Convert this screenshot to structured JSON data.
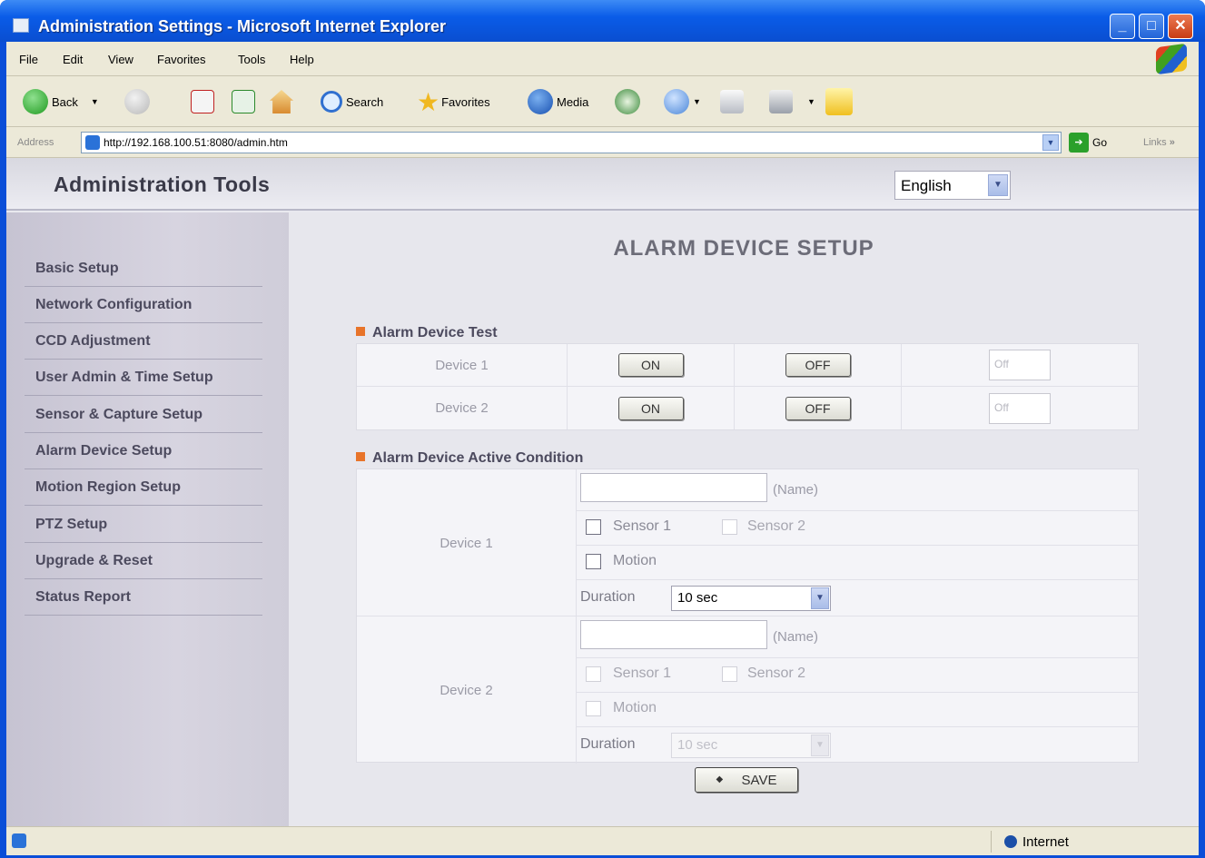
{
  "window": {
    "title": "Administration Settings - Microsoft Internet Explorer"
  },
  "menu": [
    "File",
    "Edit",
    "View",
    "Favorites",
    "Tools",
    "Help"
  ],
  "toolbar": {
    "back": "Back",
    "search": "Search",
    "favorites": "Favorites",
    "media": "Media"
  },
  "address": {
    "label": "Address",
    "url": "http://192.168.100.51:8080/admin.htm",
    "go": "Go",
    "links": "Links",
    "links_more": "»"
  },
  "header": {
    "title": "Administration Tools",
    "language": "English"
  },
  "nav": [
    "Basic Setup",
    "Network Configuration",
    "CCD Adjustment",
    "User Admin & Time Setup",
    "Sensor & Capture Setup",
    "Alarm Device Setup",
    "Motion Region Setup",
    "PTZ Setup",
    "Upgrade & Reset",
    "Status Report"
  ],
  "main": {
    "title": "ALARM DEVICE SETUP",
    "test": {
      "heading": "Alarm Device Test",
      "rows": [
        {
          "label": "Device 1",
          "on": "ON",
          "off": "OFF",
          "state": "Off"
        },
        {
          "label": "Device 2",
          "on": "ON",
          "off": "OFF",
          "state": "Off"
        }
      ]
    },
    "active": {
      "heading": "Alarm Device Active Condition",
      "devices": [
        {
          "label": "Device 1",
          "name_value": "",
          "name_hint": "(Name)",
          "sensor1": "Sensor 1",
          "sensor2": "Sensor 2",
          "motion": "Motion",
          "duration_label": "Duration",
          "duration": "10 sec"
        },
        {
          "label": "Device 2",
          "name_value": "",
          "name_hint": "(Name)",
          "sensor1": "Sensor 1",
          "sensor2": "Sensor 2",
          "motion": "Motion",
          "duration_label": "Duration",
          "duration": "10 sec"
        }
      ]
    },
    "save": "SAVE"
  },
  "status": {
    "zone": "Internet"
  },
  "icons": {
    "window": "ie-window-icon",
    "min": "minimize-icon",
    "max": "maximize-icon",
    "close": "close-icon",
    "back": "back-arrow-icon",
    "forward": "forward-arrow-icon",
    "stop": "stop-icon",
    "refresh": "refresh-icon",
    "home": "home-icon",
    "search": "search-icon",
    "favorites": "star-icon",
    "media": "media-icon",
    "history": "history-icon",
    "mail": "mail-icon",
    "print": "print-icon",
    "edit": "edit-icon",
    "messenger": "folder-icon",
    "go": "go-arrow-icon",
    "section": "bullet-icon",
    "save": "save-icon",
    "zone": "globe-icon"
  },
  "colors": {
    "titlebar": "#0A5CE8",
    "accent_bullet": "#E8742A",
    "page_bg": "#E7E7ED",
    "sidebar_bg": "#D2D0DC"
  }
}
